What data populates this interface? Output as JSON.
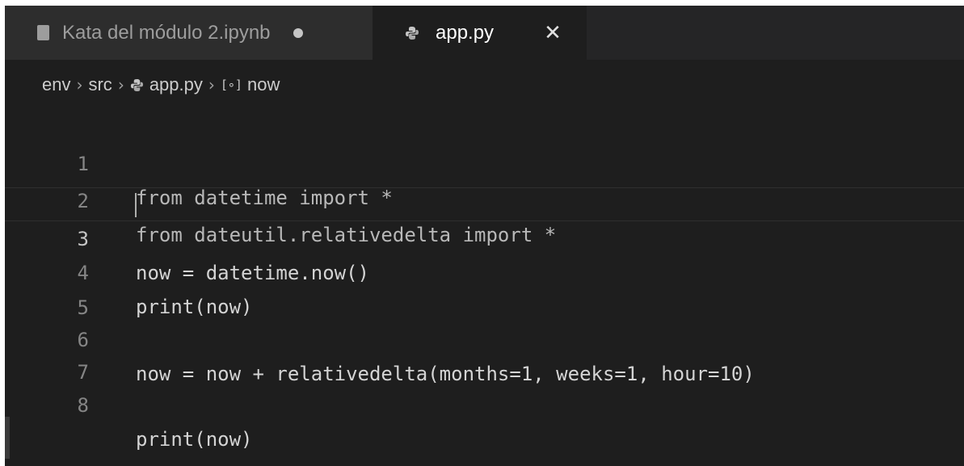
{
  "tabs": [
    {
      "label": "Kata del módulo 2.ipynb",
      "icon": "notebook-icon",
      "dirty": true,
      "active": false
    },
    {
      "label": "app.py",
      "icon": "python-icon",
      "active": true,
      "close_glyph": "✕"
    }
  ],
  "breadcrumb": [
    "env",
    "src",
    "app.py",
    "now"
  ],
  "breadcrumb_separator": "›",
  "editor": {
    "current_line": 3,
    "lines": [
      {
        "number": "1",
        "code": "from datetime import *"
      },
      {
        "number": "2",
        "code": "from dateutil.relativedelta import *"
      },
      {
        "number": "3",
        "code": "now = datetime.now()"
      },
      {
        "number": "4",
        "code": "print(now)"
      },
      {
        "number": "5",
        "code": ""
      },
      {
        "number": "6",
        "code": "now = now + relativedelta(months=1, weeks=1, hour=10)"
      },
      {
        "number": "7",
        "code": ""
      },
      {
        "number": "8",
        "code": "print(now)"
      }
    ]
  },
  "colors": {
    "editor_bg": "#1e1e1e",
    "tabbar_bg": "#252526",
    "text": "#d4d4d4",
    "line_number": "#858585"
  }
}
